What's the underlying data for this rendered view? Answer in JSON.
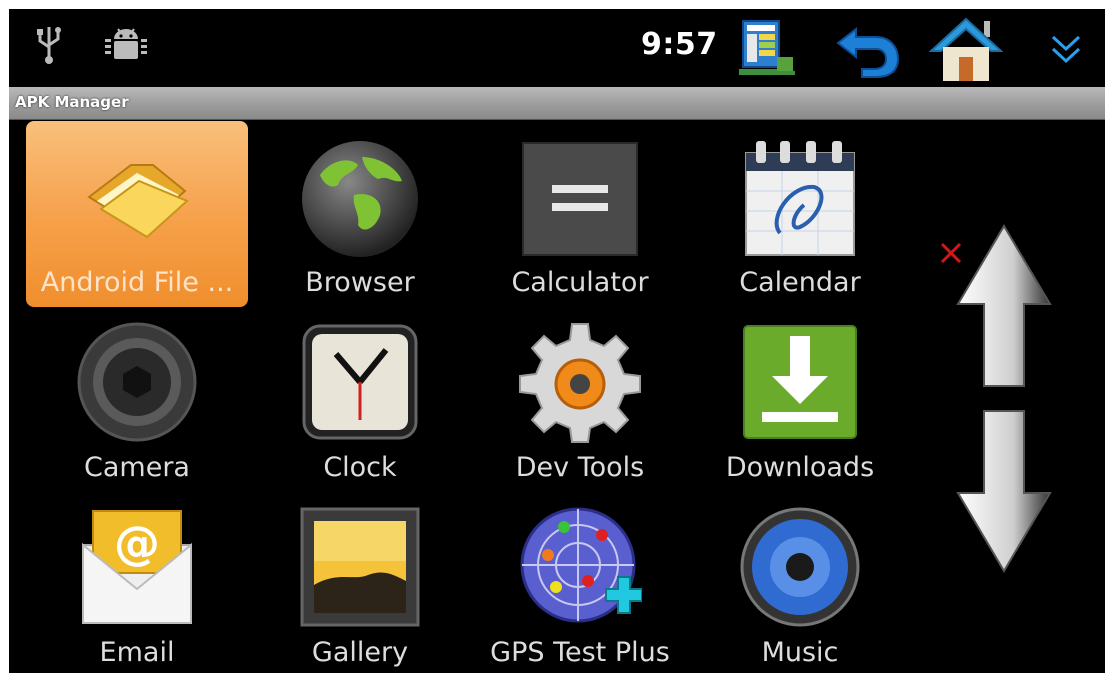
{
  "status_bar": {
    "time": "9:57",
    "icons": [
      "usb-icon",
      "android-debug-icon",
      "apk-installer-icon",
      "back-icon",
      "home-icon",
      "expand-icon"
    ]
  },
  "app_title": "APK Manager",
  "apps": [
    {
      "label": "Android File ...",
      "icon": "folder-icon",
      "selected": true
    },
    {
      "label": "Browser",
      "icon": "globe-icon"
    },
    {
      "label": "Calculator",
      "icon": "calculator-icon"
    },
    {
      "label": "Calendar",
      "icon": "calendar-icon"
    },
    {
      "label": "Camera",
      "icon": "camera-icon"
    },
    {
      "label": "Clock",
      "icon": "clock-icon"
    },
    {
      "label": "Dev Tools",
      "icon": "gear-icon"
    },
    {
      "label": "Downloads",
      "icon": "download-icon"
    },
    {
      "label": "Email",
      "icon": "email-icon"
    },
    {
      "label": "Gallery",
      "icon": "gallery-icon"
    },
    {
      "label": "GPS Test Plus",
      "icon": "gps-radar-icon"
    },
    {
      "label": "Music",
      "icon": "speaker-icon"
    }
  ],
  "controls": {
    "close_icon": "close-icon",
    "scroll_up_icon": "arrow-up-icon",
    "scroll_down_icon": "arrow-down-icon"
  },
  "colors": {
    "selection": "#f6a24d",
    "title_bar": "#a6a6a6",
    "accent_blue": "#1d7fd6"
  }
}
